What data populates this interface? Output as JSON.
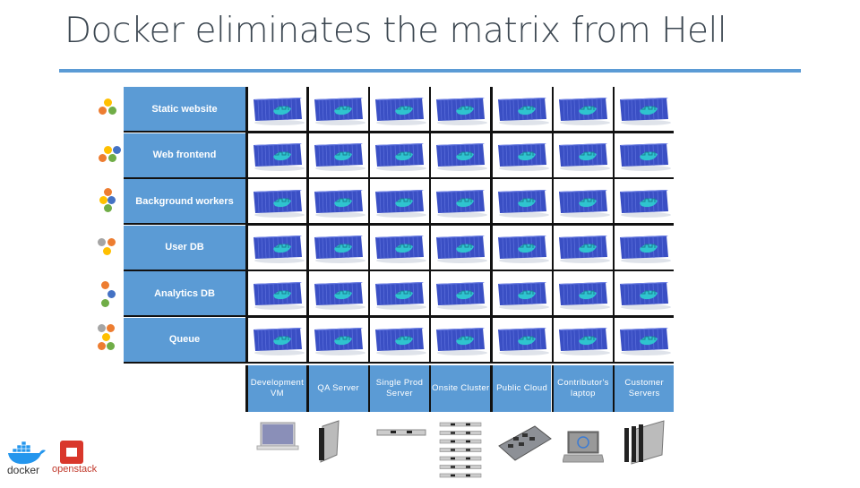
{
  "slide": {
    "title": "Docker eliminates the matrix from Hell",
    "accent_color": "#5b9bd5"
  },
  "rows": [
    {
      "label": "Static website",
      "icon": "colored-hexagon-cluster"
    },
    {
      "label": "Web frontend",
      "icon": "colored-hexagon-cluster"
    },
    {
      "label": "Background workers",
      "icon": "colored-hexagon-cluster"
    },
    {
      "label": "User DB",
      "icon": "colored-hexagon-cluster"
    },
    {
      "label": "Analytics DB",
      "icon": "colored-hexagon-cluster"
    },
    {
      "label": "Queue",
      "icon": "colored-hexagon-cluster"
    }
  ],
  "columns": [
    {
      "label": "Development VM",
      "hardware_icon": "laptop-icon"
    },
    {
      "label": "QA Server",
      "hardware_icon": "blade-server-icon"
    },
    {
      "label": "Single Prod Server",
      "hardware_icon": "rack-server-icon"
    },
    {
      "label": "Onsite Cluster",
      "hardware_icon": "server-cluster-icon"
    },
    {
      "label": "Public Cloud",
      "hardware_icon": "motherboard-icon"
    },
    {
      "label": "Contributor's laptop",
      "hardware_icon": "dell-laptop-icon"
    },
    {
      "label": "Customer Servers",
      "hardware_icon": "blade-chassis-icon"
    }
  ],
  "cell_icon": "docker-container-icon",
  "logos": {
    "docker": "docker",
    "openstack": "openstack"
  }
}
